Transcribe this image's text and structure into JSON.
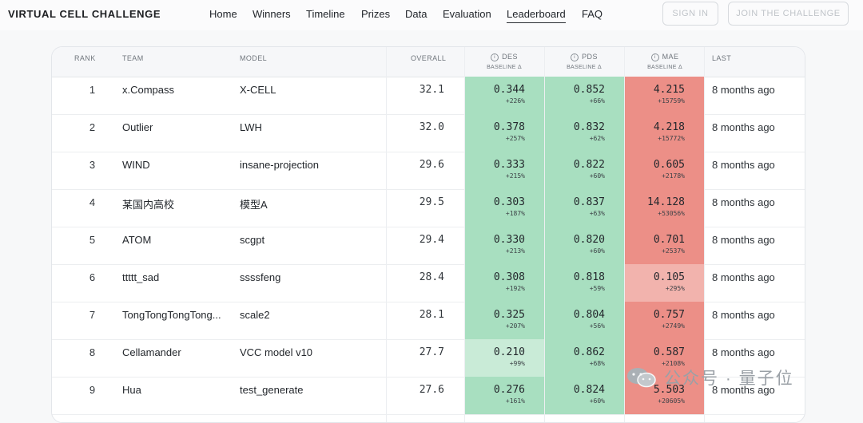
{
  "brand": "VIRTUAL CELL CHALLENGE",
  "nav": [
    {
      "label": "Home",
      "active": false
    },
    {
      "label": "Winners",
      "active": false
    },
    {
      "label": "Timeline",
      "active": false
    },
    {
      "label": "Prizes",
      "active": false
    },
    {
      "label": "Data",
      "active": false
    },
    {
      "label": "Evaluation",
      "active": false
    },
    {
      "label": "Leaderboard",
      "active": true
    },
    {
      "label": "FAQ",
      "active": false
    }
  ],
  "buttons": {
    "sign_in": "SIGN IN",
    "join": "JOIN THE CHALLENGE"
  },
  "table": {
    "headers": {
      "rank": "RANK",
      "team": "TEAM",
      "model": "MODEL",
      "overall": "OVERALL",
      "des": "DES",
      "pds": "PDS",
      "mae": "MAE",
      "baseline": "BASELINE Δ",
      "last": "LAST"
    },
    "rows": [
      {
        "rank": "1",
        "team": "x.Compass",
        "model": "X-CELL",
        "overall": "32.1",
        "des": "0.344",
        "des_delta": "+226%",
        "pds": "0.852",
        "pds_delta": "+66%",
        "mae": "4.215",
        "mae_delta": "+15759%",
        "last": "8 months ago"
      },
      {
        "rank": "2",
        "team": "Outlier",
        "model": "LWH",
        "overall": "32.0",
        "des": "0.378",
        "des_delta": "+257%",
        "pds": "0.832",
        "pds_delta": "+62%",
        "mae": "4.218",
        "mae_delta": "+15772%",
        "last": "8 months ago"
      },
      {
        "rank": "3",
        "team": "WIND",
        "model": "insane-projection",
        "overall": "29.6",
        "des": "0.333",
        "des_delta": "+215%",
        "pds": "0.822",
        "pds_delta": "+60%",
        "mae": "0.605",
        "mae_delta": "+2178%",
        "last": "8 months ago"
      },
      {
        "rank": "4",
        "team": "某国内高校",
        "model": "模型A",
        "overall": "29.5",
        "des": "0.303",
        "des_delta": "+187%",
        "pds": "0.837",
        "pds_delta": "+63%",
        "mae": "14.128",
        "mae_delta": "+53056%",
        "last": "8 months ago"
      },
      {
        "rank": "5",
        "team": "ATOM",
        "model": "scgpt",
        "overall": "29.4",
        "des": "0.330",
        "des_delta": "+213%",
        "pds": "0.820",
        "pds_delta": "+60%",
        "mae": "0.701",
        "mae_delta": "+2537%",
        "last": "8 months ago"
      },
      {
        "rank": "6",
        "team": "ttttt_sad",
        "model": "ssssfeng",
        "overall": "28.4",
        "des": "0.308",
        "des_delta": "+192%",
        "pds": "0.818",
        "pds_delta": "+59%",
        "mae": "0.105",
        "mae_delta": "+295%",
        "last": "8 months ago"
      },
      {
        "rank": "7",
        "team": "TongTongTongTong...",
        "model": "scale2",
        "overall": "28.1",
        "des": "0.325",
        "des_delta": "+207%",
        "pds": "0.804",
        "pds_delta": "+56%",
        "mae": "0.757",
        "mae_delta": "+2749%",
        "last": "8 months ago"
      },
      {
        "rank": "8",
        "team": "Cellamander",
        "model": "VCC model v10",
        "overall": "27.7",
        "des": "0.210",
        "des_delta": "+99%",
        "pds": "0.862",
        "pds_delta": "+68%",
        "mae": "0.587",
        "mae_delta": "+2108%",
        "last": "8 months ago"
      },
      {
        "rank": "9",
        "team": "Hua",
        "model": "test_generate",
        "overall": "27.6",
        "des": "0.276",
        "des_delta": "+161%",
        "pds": "0.824",
        "pds_delta": "+60%",
        "mae": "5.503",
        "mae_delta": "+20605%",
        "last": "8 months ago"
      }
    ]
  },
  "colors": {
    "green_strong": "#a8dfc0",
    "green_light": "#c9ebd7",
    "red_strong": "#ec8f87",
    "red_light": "#f2b3ad"
  },
  "watermark": {
    "text": "公众号 · 量子位",
    "icon": "wechat-icon"
  }
}
